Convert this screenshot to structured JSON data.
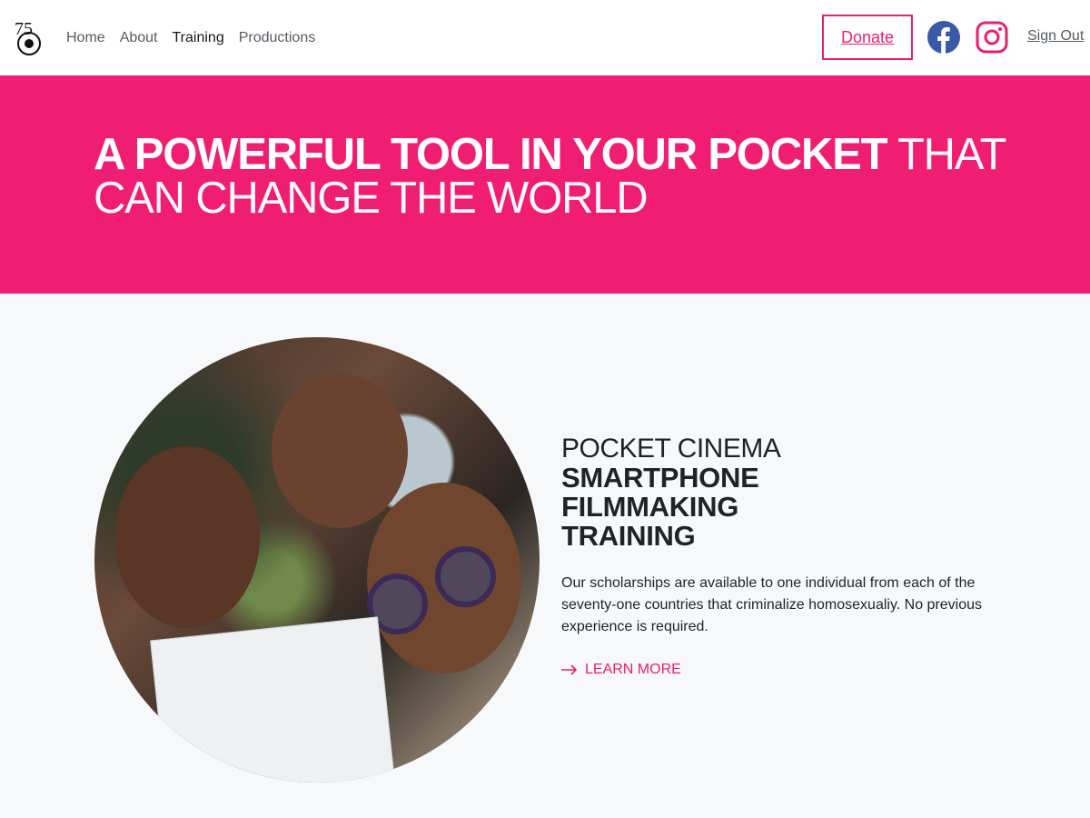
{
  "header": {
    "logo_text": "75",
    "nav": [
      {
        "label": "Home",
        "active": false
      },
      {
        "label": "About",
        "active": false
      },
      {
        "label": "Training",
        "active": true
      },
      {
        "label": "Productions",
        "active": false
      }
    ],
    "donate_label": "Donate",
    "signout_label": "Sign Out",
    "icons": [
      "facebook-icon",
      "instagram-icon"
    ]
  },
  "hero": {
    "headline_bold": "A POWERFUL TOOL IN YOUR POCKET",
    "headline_light_1": " THAT",
    "headline_light_2": "CAN CHANGE THE WORLD",
    "background": "#ef1e72"
  },
  "feature": {
    "eyebrow": "POCKET CINEMA",
    "title_lines": [
      "SMARTPHONE",
      "FILMMAKING",
      "TRAINING"
    ],
    "description": "Our scholarships are available to one individual from each of the seventy-one countries that criminalize homosexualiy. No previous experience is required.",
    "cta_label": "LEARN MORE",
    "accent": "#e91e72"
  }
}
